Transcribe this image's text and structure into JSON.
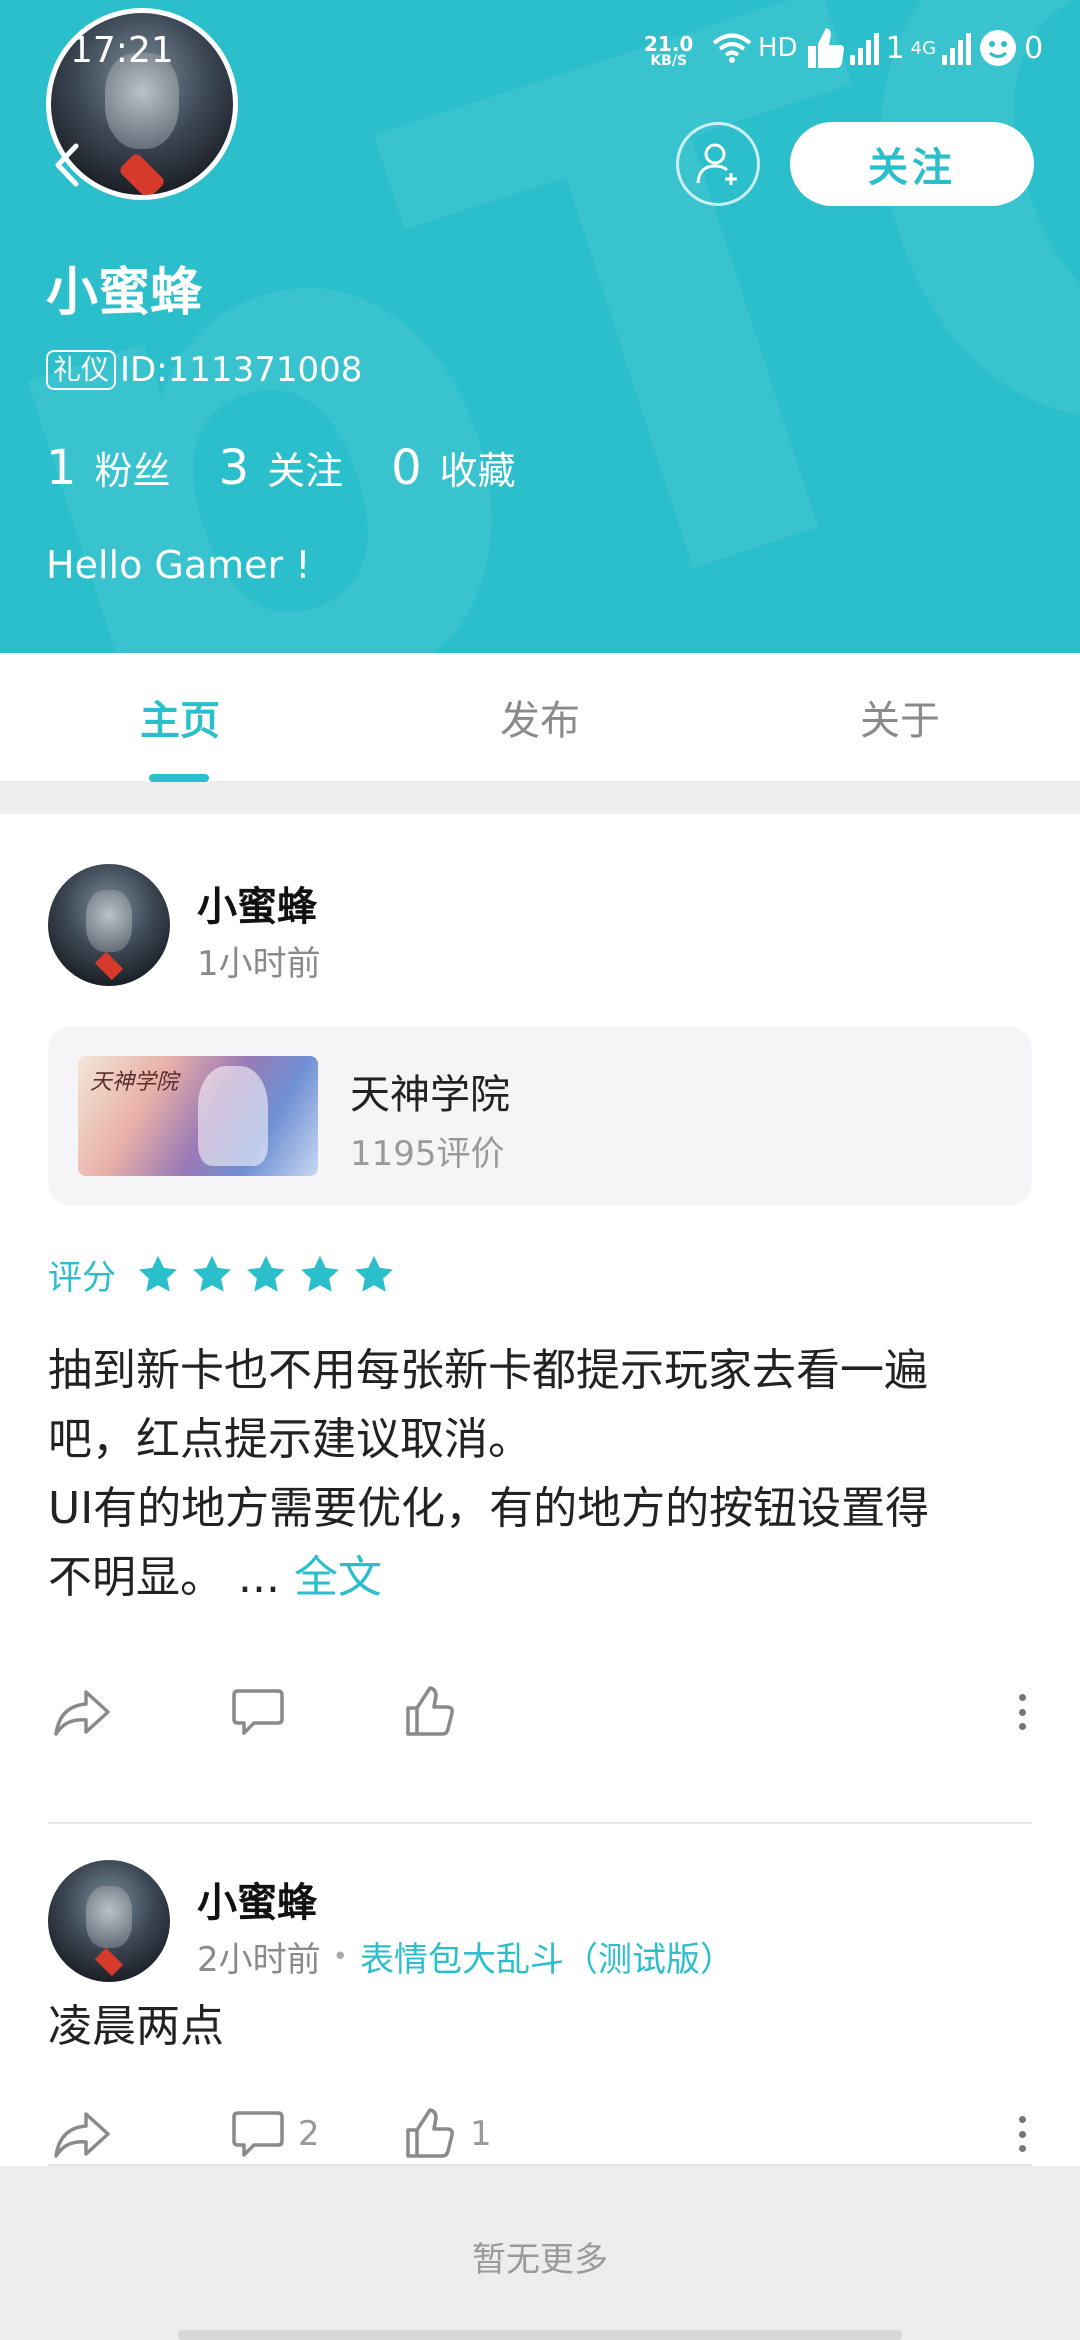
{
  "status_bar": {
    "time": "17:21",
    "speed_value": "21.0",
    "speed_unit": "KB/S",
    "hd_label": "HD",
    "notif_count_1": "1",
    "net_label": "4G",
    "notif_count_2": "0"
  },
  "profile": {
    "name": "小蜜蜂",
    "badge": "礼仪",
    "id_text": "ID:111371008",
    "stats": [
      {
        "num": "1",
        "label": "粉丝"
      },
      {
        "num": "3",
        "label": "关注"
      },
      {
        "num": "0",
        "label": "收藏"
      }
    ],
    "bio": "Hello Gamer !",
    "follow_label": "关注",
    "watermark": "pTO"
  },
  "tabs": [
    {
      "label": "主页",
      "active": true
    },
    {
      "label": "发布",
      "active": false
    },
    {
      "label": "关于",
      "active": false
    }
  ],
  "posts": [
    {
      "author": "小蜜蜂",
      "time": "1小时前",
      "game": {
        "title": "天神学院",
        "reviews": "1195评价",
        "logo_text": "天神学院"
      },
      "rating_label": "评分",
      "rating_value": 5,
      "body_lines": [
        "抽到新卡也不用每张新卡都提示玩家去看一遍",
        "吧，红点提示建议取消。",
        "UI有的地方需要优化，有的地方的按钮设置得",
        "不明显。 ... "
      ],
      "more_label": "全文"
    },
    {
      "author": "小蜜蜂",
      "time": "2小时前",
      "dot": "•",
      "game_link": "表情包大乱斗（测试版）",
      "body": "凌晨两点",
      "comment_count": "2",
      "like_count": "1"
    }
  ],
  "footer": {
    "no_more": "暂无更多"
  },
  "colors": {
    "accent": "#2bbfcb",
    "background": "#ededed",
    "muted_text": "#8a8a8a"
  }
}
